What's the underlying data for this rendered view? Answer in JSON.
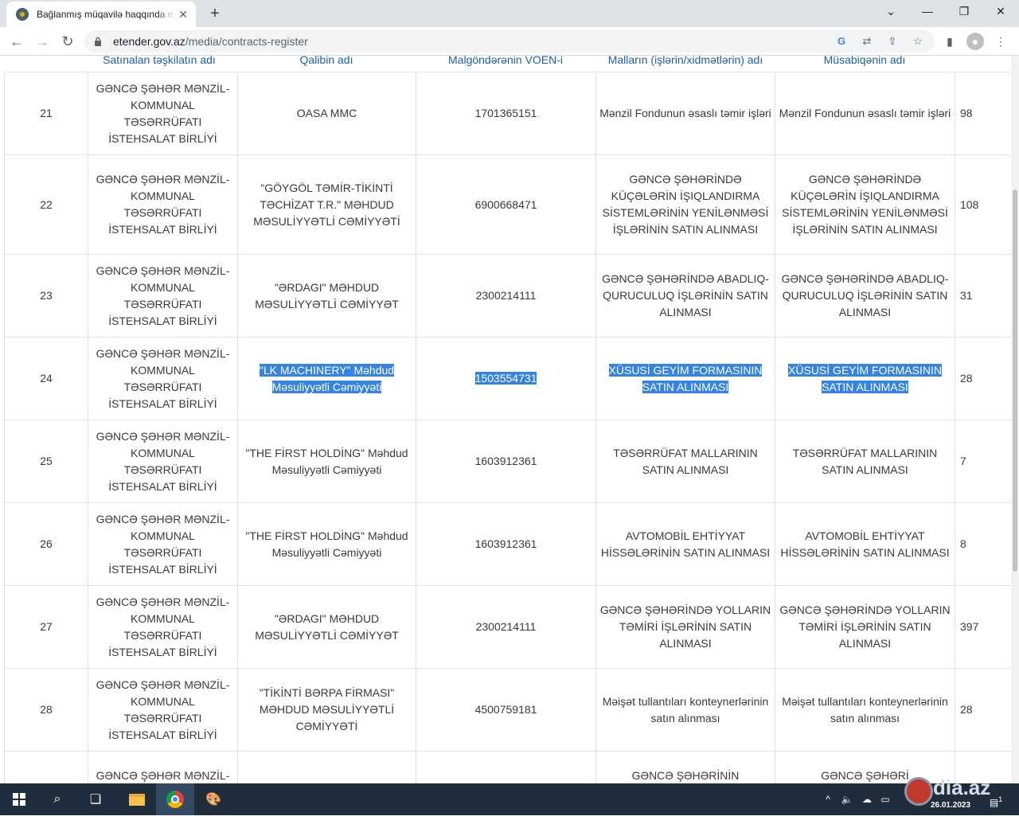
{
  "browser": {
    "tab_title": "Bağlanmış müqavilə haqqında məlumat",
    "url_host": "etender.gov.az",
    "url_path": "/media/contracts-register"
  },
  "table": {
    "headers": [
      "",
      "Satınalan təşkilatın adı",
      "Qalibin adı",
      "Malgöndərənin VÖEN-i",
      "Malların (işlərin/xidmətlərin) adı",
      "Müsabiqənin adı",
      ""
    ],
    "rows": [
      {
        "no": "21",
        "org": "GƏNCƏ ŞƏHƏR MƏNZİL-KOMMUNAL TƏSƏRRÜFATI İSTEHSALAT BİRLİYİ",
        "winner": "OASA MMC",
        "voen": "1701365151",
        "goods": "Mənzil Fondunun əsaslı təmir işləri",
        "tender": "Mənzil Fondunun əsaslı təmir işləri",
        "amount": "98"
      },
      {
        "no": "22",
        "org": "GƏNCƏ ŞƏHƏR MƏNZİL-KOMMUNAL TƏSƏRRÜFATI İSTEHSALAT BİRLİYİ",
        "winner": "\"GÖYGÖL TƏMİR-TİKİNTİ TƏCHİZAT T.R.\" MƏHDUD MƏSULİYYƏTLİ CƏMİYYƏTİ",
        "voen": "6900668471",
        "goods": "GƏNCƏ ŞƏHƏRİNDƏ KÜÇƏLƏRİN İŞIQLANDIRMA SİSTEMLƏRİNİN YENİLƏNMƏSİ İŞLƏRİNİN SATIN ALINMASI",
        "tender": "GƏNCƏ ŞƏHƏRİNDƏ KÜÇƏLƏRİN İŞIQLANDIRMA SİSTEMLƏRİNİN YENİLƏNMƏSİ İŞLƏRİNİN SATIN ALINMASI",
        "amount": "108"
      },
      {
        "no": "23",
        "org": "GƏNCƏ ŞƏHƏR MƏNZİL-KOMMUNAL TƏSƏRRÜFATI İSTEHSALAT BİRLİYİ",
        "winner": "\"ƏRDAGI\" MƏHDUD MƏSULİYYƏTLİ CƏMİYYƏT",
        "voen": "2300214111",
        "goods": "GƏNCƏ ŞƏHƏRİNDƏ ABADLIQ-QURUCULUQ İŞLƏRİNİN SATIN ALINMASI",
        "tender": "GƏNCƏ ŞƏHƏRİNDƏ ABADLIQ-QURUCULUQ İŞLƏRİNİN SATIN ALINMASI",
        "amount": "31"
      },
      {
        "no": "24",
        "org": "GƏNCƏ ŞƏHƏR MƏNZİL-KOMMUNAL TƏSƏRRÜFATI İSTEHSALAT BİRLİYİ",
        "winner": "\"LK MACHINERY\" Məhdud Məsuliyyətli Cəmiyyəti",
        "voen": "1503554731",
        "goods": "XÜSUSİ GEYİM FORMASININ SATIN ALINMASI",
        "tender": "XÜSUSİ GEYİM FORMASININ SATIN ALINMASI",
        "amount": "28",
        "selected": true
      },
      {
        "no": "25",
        "org": "GƏNCƏ ŞƏHƏR MƏNZİL-KOMMUNAL TƏSƏRRÜFATI İSTEHSALAT BİRLİYİ",
        "winner": "\"THE FİRST HOLDİNG\" Məhdud Məsuliyyətli Cəmiyyəti",
        "voen": "1603912361",
        "goods": "TƏSƏRRÜFAT MALLARININ SATIN ALINMASI",
        "tender": "TƏSƏRRÜFAT MALLARININ SATIN ALINMASI",
        "amount": "7"
      },
      {
        "no": "26",
        "org": "GƏNCƏ ŞƏHƏR MƏNZİL-KOMMUNAL TƏSƏRRÜFATI İSTEHSALAT BİRLİYİ",
        "winner": "\"THE FİRST HOLDİNG\" Məhdud Məsuliyyətli Cəmiyyəti",
        "voen": "1603912361",
        "goods": "AVTOMOBİL EHTİYYAT HİSSƏLƏRİNİN SATIN ALINMASI",
        "tender": "AVTOMOBİL EHTİYYAT HİSSƏLƏRİNİN SATIN ALINMASI",
        "amount": "8"
      },
      {
        "no": "27",
        "org": "GƏNCƏ ŞƏHƏR MƏNZİL-KOMMUNAL TƏSƏRRÜFATI İSTEHSALAT BİRLİYİ",
        "winner": "\"ƏRDAGI\" MƏHDUD MƏSULİYYƏTLİ CƏMİYYƏT",
        "voen": "2300214111",
        "goods": "GƏNCƏ ŞƏHƏRİNDƏ YOLLARIN TƏMİRİ İŞLƏRİNİN SATIN ALINMASI",
        "tender": "GƏNCƏ ŞƏHƏRİNDƏ YOLLARIN TƏMİRİ İŞLƏRİNİN SATIN ALINMASI",
        "amount": "397"
      },
      {
        "no": "28",
        "org": "GƏNCƏ ŞƏHƏR MƏNZİL-KOMMUNAL TƏSƏRRÜFATI İSTEHSALAT BİRLİYİ",
        "winner": "\"TİKİNTİ BƏRPA FİRMASI\" MƏHDUD MƏSULİYYƏTLİ CƏMİYYƏTİ",
        "voen": "4500759181",
        "goods": "Məişət tullantıları konteynerlərinin satın alınması",
        "tender": "Məişət tullantıları konteynerlərinin satın alınması",
        "amount": "28"
      },
      {
        "no": "",
        "org": "GƏNCƏ ŞƏHƏR MƏNZİL-",
        "winner": "",
        "voen": "",
        "goods": "GƏNCƏ ŞƏHƏRİNİN",
        "tender": "GƏNCƏ ŞƏHƏRİ",
        "amount": ""
      }
    ]
  },
  "taskbar": {
    "clock_date": "26.01.2023",
    "notification_count": "1"
  },
  "watermark": {
    "text": "dia.az"
  }
}
